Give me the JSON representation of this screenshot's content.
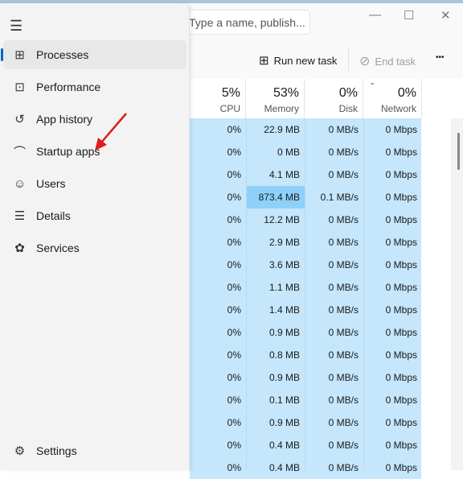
{
  "search": {
    "placeholder": "Type a name, publish..."
  },
  "window": {
    "minimize": "—",
    "maximize": "☐",
    "close": "✕"
  },
  "toolbar": {
    "run_new_task": "Run new task",
    "end_task": "End task",
    "more": "•••"
  },
  "columns": [
    {
      "pct": "5%",
      "label": "CPU"
    },
    {
      "pct": "53%",
      "label": "Memory"
    },
    {
      "pct": "0%",
      "label": "Disk"
    },
    {
      "pct": "0%",
      "label": "Network"
    }
  ],
  "sort_indicator": "ˇ",
  "rows": [
    [
      "0%",
      "22.9 MB",
      "0 MB/s",
      "0 Mbps"
    ],
    [
      "0%",
      "0 MB",
      "0 MB/s",
      "0 Mbps"
    ],
    [
      "0%",
      "4.1 MB",
      "0 MB/s",
      "0 Mbps"
    ],
    [
      "0%",
      "873.4 MB",
      "0.1 MB/s",
      "0 Mbps"
    ],
    [
      "0%",
      "12.2 MB",
      "0 MB/s",
      "0 Mbps"
    ],
    [
      "0%",
      "2.9 MB",
      "0 MB/s",
      "0 Mbps"
    ],
    [
      "0%",
      "3.6 MB",
      "0 MB/s",
      "0 Mbps"
    ],
    [
      "0%",
      "1.1 MB",
      "0 MB/s",
      "0 Mbps"
    ],
    [
      "0%",
      "1.4 MB",
      "0 MB/s",
      "0 Mbps"
    ],
    [
      "0%",
      "0.9 MB",
      "0 MB/s",
      "0 Mbps"
    ],
    [
      "0%",
      "0.8 MB",
      "0 MB/s",
      "0 Mbps"
    ],
    [
      "0%",
      "0.9 MB",
      "0 MB/s",
      "0 Mbps"
    ],
    [
      "0%",
      "0.1 MB",
      "0 MB/s",
      "0 Mbps"
    ],
    [
      "0%",
      "0.9 MB",
      "0 MB/s",
      "0 Mbps"
    ],
    [
      "0%",
      "0.4 MB",
      "0 MB/s",
      "0 Mbps"
    ],
    [
      "0%",
      "0.4 MB",
      "0 MB/s",
      "0 Mbps"
    ]
  ],
  "sidebar": {
    "items": [
      {
        "label": "Processes",
        "icon": "processes-icon",
        "glyph": "⊞",
        "active": true
      },
      {
        "label": "Performance",
        "icon": "performance-icon",
        "glyph": "⊡"
      },
      {
        "label": "App history",
        "icon": "history-icon",
        "glyph": "↺"
      },
      {
        "label": "Startup apps",
        "icon": "startup-icon",
        "glyph": "⌒"
      },
      {
        "label": "Users",
        "icon": "users-icon",
        "glyph": "☺"
      },
      {
        "label": "Details",
        "icon": "details-icon",
        "glyph": "☰"
      },
      {
        "label": "Services",
        "icon": "services-icon",
        "glyph": "✿"
      }
    ],
    "settings": {
      "label": "Settings",
      "glyph": "⚙"
    }
  },
  "colors": {
    "accent": "#0067c0",
    "row": "#c5e6fb",
    "highlight": "#8dd1fb",
    "arrow": "#e01b1b"
  }
}
